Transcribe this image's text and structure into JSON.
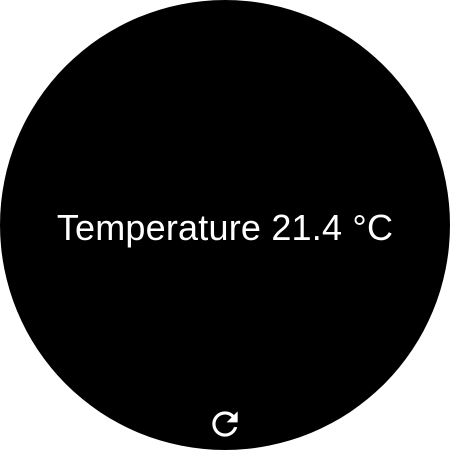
{
  "screen": {
    "background_color": "#000000",
    "text_color": "#ffffff"
  },
  "reading": {
    "label": "Temperature",
    "value": "21.4",
    "unit": "°C"
  },
  "actions": {
    "refresh_icon": "refresh-icon"
  }
}
